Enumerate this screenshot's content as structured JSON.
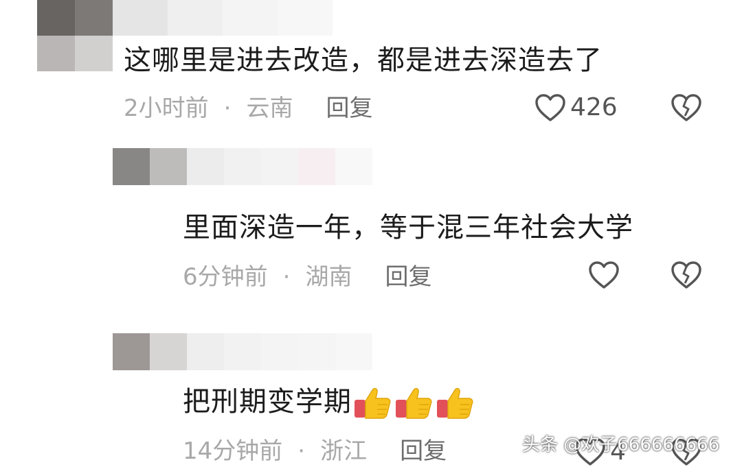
{
  "comments": [
    {
      "text": "这哪里是进去改造，都是进去深造去了",
      "time": "2小时前",
      "sep": "·",
      "location": "云南",
      "reply": "回复",
      "likes": "426"
    },
    {
      "text": "里面深造一年，等于混三年社会大学",
      "time": "6分钟前",
      "sep": "·",
      "location": "湖南",
      "reply": "回复",
      "likes": ""
    },
    {
      "text": "把刑期变学期",
      "emoji": "thumbs-up-icon",
      "emoji_count": 3,
      "time": "14分钟前",
      "sep": "·",
      "location": "浙江",
      "reply": "回复",
      "likes": "4"
    }
  ],
  "watermark": "头条 @欢子666666666",
  "colors": {
    "text": "#1c1c1c",
    "meta": "#a8a8a8",
    "reply": "#6d6d6d",
    "icon": "#555555"
  }
}
